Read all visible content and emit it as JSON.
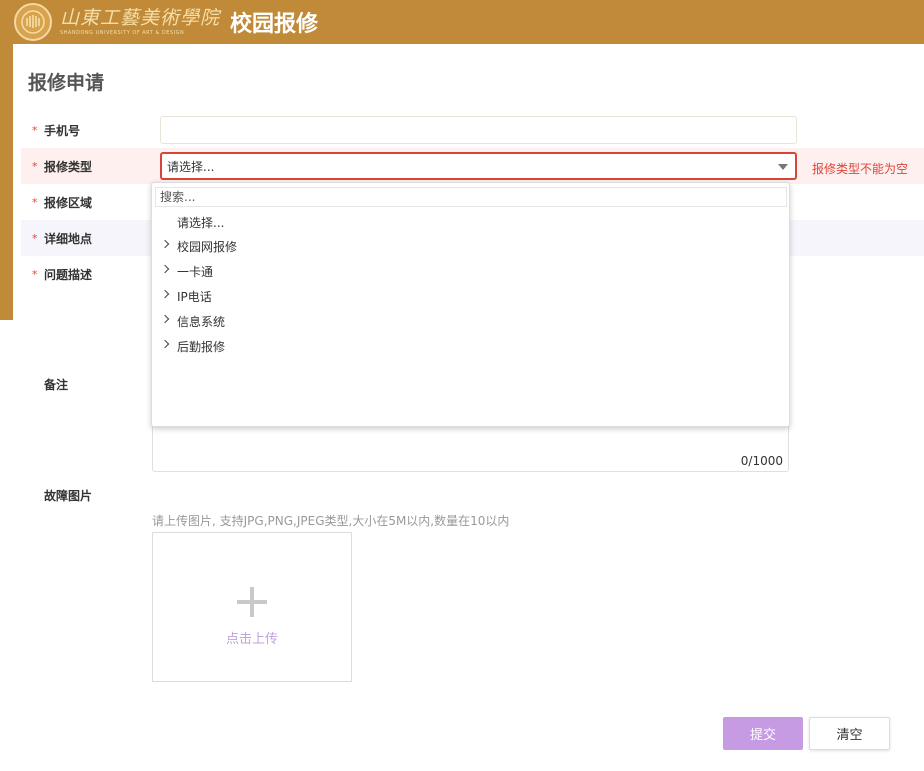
{
  "header": {
    "logo_cn": "山東工藝美術學院",
    "logo_en": "SHANDONG UNIVERSITY OF ART & DESIGN",
    "app_title": "校园报修"
  },
  "form": {
    "title": "报修申请",
    "required_mark": "*",
    "fields": {
      "phone": {
        "label": "手机号",
        "value": ""
      },
      "type": {
        "label": "报修类型",
        "value": "请选择...",
        "error": "报修类型不能为空"
      },
      "area": {
        "label": "报修区域"
      },
      "location": {
        "label": "详细地点"
      },
      "description": {
        "label": "问题描述"
      },
      "notes": {
        "label": "备注",
        "counter": "0/1000"
      },
      "images": {
        "label": "故障图片",
        "hint": "请上传图片, 支持JPG,PNG,JPEG类型,大小在5M以内,数量在10以内",
        "upload_label": "点击上传"
      }
    },
    "buttons": {
      "submit": "提交",
      "clear": "清空"
    }
  },
  "dropdown": {
    "search_placeholder": "搜索...",
    "options": [
      {
        "label": "请选择...",
        "expandable": false
      },
      {
        "label": "校园网报修",
        "expandable": true
      },
      {
        "label": "一卡通",
        "expandable": true
      },
      {
        "label": "IP电话",
        "expandable": true
      },
      {
        "label": "信息系统",
        "expandable": true
      },
      {
        "label": "后勤报修",
        "expandable": true
      }
    ]
  },
  "colors": {
    "brand": "#c08a38",
    "error": "#e0443a",
    "accent": "#c79ae4"
  }
}
